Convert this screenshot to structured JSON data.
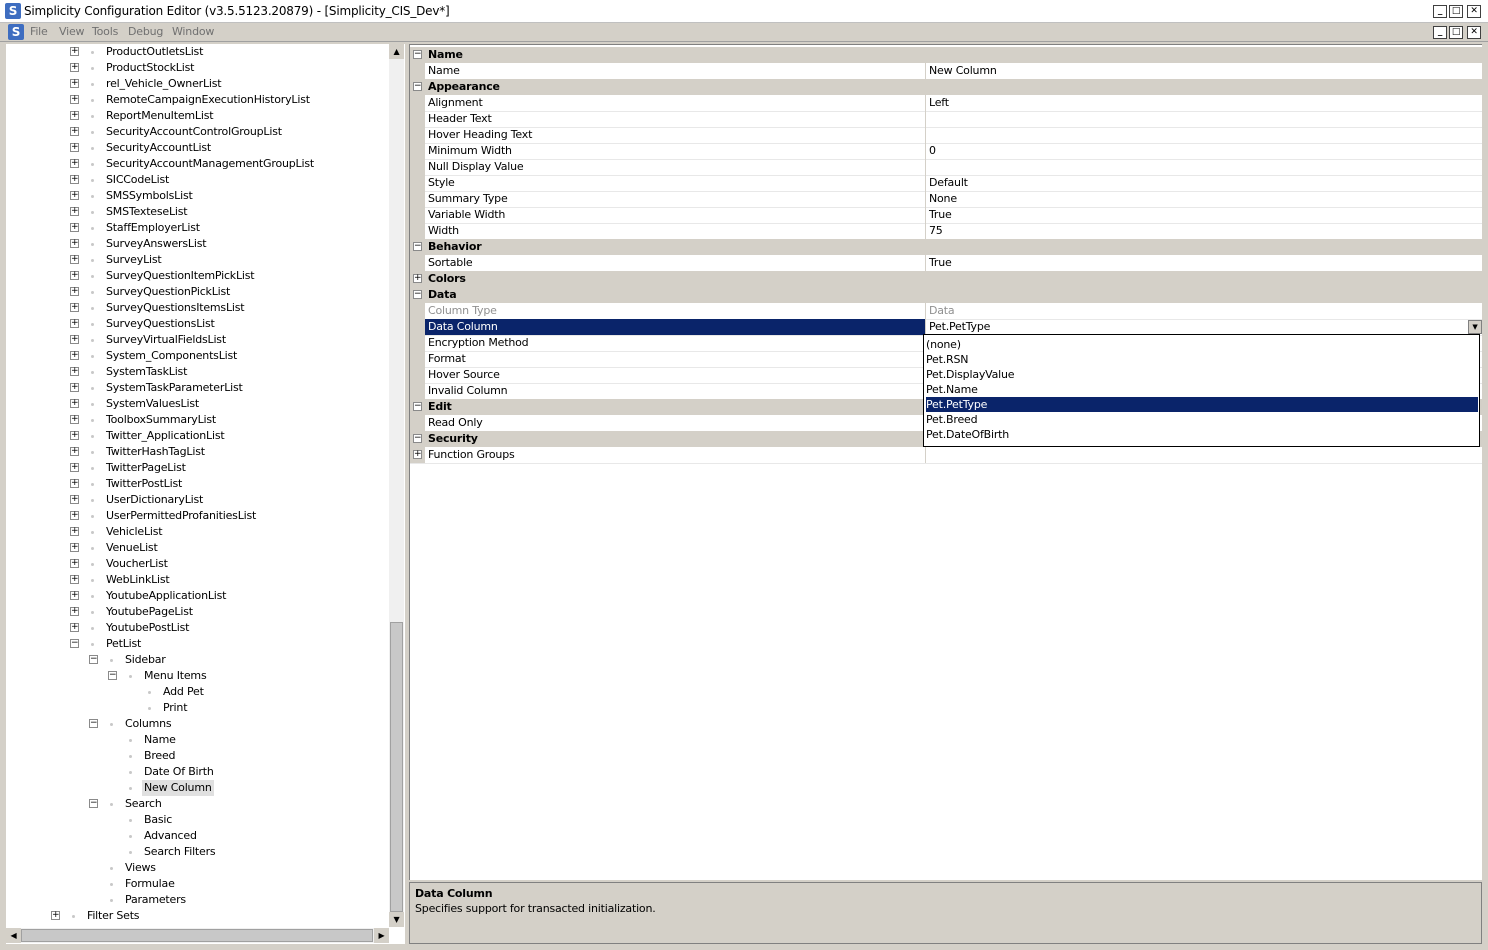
{
  "window": {
    "title": "Simplicity Configuration Editor (v3.5.5123.20879) - [Simplicity_CIS_Dev*]",
    "app_icon": "S",
    "minimize": "_",
    "maximize": "□",
    "close": "✕"
  },
  "menu": {
    "items": [
      "File",
      "View",
      "Tools",
      "Debug",
      "Window"
    ]
  },
  "tree": {
    "items": [
      {
        "label": "ProductOutletsList",
        "depth": 0,
        "expander": "+"
      },
      {
        "label": "ProductStockList",
        "depth": 0,
        "expander": "+"
      },
      {
        "label": "rel_Vehicle_OwnerList",
        "depth": 0,
        "expander": "+"
      },
      {
        "label": "RemoteCampaignExecutionHistoryList",
        "depth": 0,
        "expander": "+"
      },
      {
        "label": "ReportMenuItemList",
        "depth": 0,
        "expander": "+"
      },
      {
        "label": "SecurityAccountControlGroupList",
        "depth": 0,
        "expander": "+"
      },
      {
        "label": "SecurityAccountList",
        "depth": 0,
        "expander": "+"
      },
      {
        "label": "SecurityAccountManagementGroupList",
        "depth": 0,
        "expander": "+"
      },
      {
        "label": "SICCodeList",
        "depth": 0,
        "expander": "+"
      },
      {
        "label": "SMSSymbolsList",
        "depth": 0,
        "expander": "+"
      },
      {
        "label": "SMSTexteseList",
        "depth": 0,
        "expander": "+"
      },
      {
        "label": "StaffEmployerList",
        "depth": 0,
        "expander": "+"
      },
      {
        "label": "SurveyAnswersList",
        "depth": 0,
        "expander": "+"
      },
      {
        "label": "SurveyList",
        "depth": 0,
        "expander": "+"
      },
      {
        "label": "SurveyQuestionItemPickList",
        "depth": 0,
        "expander": "+"
      },
      {
        "label": "SurveyQuestionPickList",
        "depth": 0,
        "expander": "+"
      },
      {
        "label": "SurveyQuestionsItemsList",
        "depth": 0,
        "expander": "+"
      },
      {
        "label": "SurveyQuestionsList",
        "depth": 0,
        "expander": "+"
      },
      {
        "label": "SurveyVirtualFieldsList",
        "depth": 0,
        "expander": "+"
      },
      {
        "label": "System_ComponentsList",
        "depth": 0,
        "expander": "+"
      },
      {
        "label": "SystemTaskList",
        "depth": 0,
        "expander": "+"
      },
      {
        "label": "SystemTaskParameterList",
        "depth": 0,
        "expander": "+"
      },
      {
        "label": "SystemValuesList",
        "depth": 0,
        "expander": "+"
      },
      {
        "label": "ToolboxSummaryList",
        "depth": 0,
        "expander": "+"
      },
      {
        "label": "Twitter_ApplicationList",
        "depth": 0,
        "expander": "+"
      },
      {
        "label": "TwitterHashTagList",
        "depth": 0,
        "expander": "+"
      },
      {
        "label": "TwitterPageList",
        "depth": 0,
        "expander": "+"
      },
      {
        "label": "TwitterPostList",
        "depth": 0,
        "expander": "+"
      },
      {
        "label": "UserDictionaryList",
        "depth": 0,
        "expander": "+"
      },
      {
        "label": "UserPermittedProfanitiesList",
        "depth": 0,
        "expander": "+"
      },
      {
        "label": "VehicleList",
        "depth": 0,
        "expander": "+"
      },
      {
        "label": "VenueList",
        "depth": 0,
        "expander": "+"
      },
      {
        "label": "VoucherList",
        "depth": 0,
        "expander": "+"
      },
      {
        "label": "WebLinkList",
        "depth": 0,
        "expander": "+"
      },
      {
        "label": "YoutubeApplicationList",
        "depth": 0,
        "expander": "+"
      },
      {
        "label": "YoutubePageList",
        "depth": 0,
        "expander": "+"
      },
      {
        "label": "YoutubePostList",
        "depth": 0,
        "expander": "+"
      },
      {
        "label": "PetList",
        "depth": 0,
        "expander": "-"
      },
      {
        "label": "Sidebar",
        "depth": 1,
        "expander": "-"
      },
      {
        "label": "Menu Items",
        "depth": 2,
        "expander": "-"
      },
      {
        "label": "Add Pet",
        "depth": 3,
        "expander": ""
      },
      {
        "label": "Print",
        "depth": 3,
        "expander": ""
      },
      {
        "label": "Columns",
        "depth": 1,
        "expander": "-"
      },
      {
        "label": "Name",
        "depth": 2,
        "expander": ""
      },
      {
        "label": "Breed",
        "depth": 2,
        "expander": ""
      },
      {
        "label": "Date Of Birth",
        "depth": 2,
        "expander": ""
      },
      {
        "label": "New Column",
        "depth": 2,
        "expander": "",
        "selected": true
      },
      {
        "label": "Search",
        "depth": 1,
        "expander": "-"
      },
      {
        "label": "Basic",
        "depth": 2,
        "expander": ""
      },
      {
        "label": "Advanced",
        "depth": 2,
        "expander": ""
      },
      {
        "label": "Search Filters",
        "depth": 2,
        "expander": ""
      },
      {
        "label": "Views",
        "depth": 1,
        "expander": ""
      },
      {
        "label": "Formulae",
        "depth": 1,
        "expander": ""
      },
      {
        "label": "Parameters",
        "depth": 1,
        "expander": ""
      },
      {
        "label": "Filter Sets",
        "depth": -1,
        "expander": "+"
      }
    ]
  },
  "properties": {
    "rows": [
      {
        "type": "category",
        "label": "Name",
        "expander": "-"
      },
      {
        "type": "prop",
        "name": "Name",
        "value": "New Column"
      },
      {
        "type": "category",
        "label": "Appearance",
        "expander": "-"
      },
      {
        "type": "prop",
        "name": "Alignment",
        "value": "Left"
      },
      {
        "type": "prop",
        "name": "Header Text",
        "value": ""
      },
      {
        "type": "prop",
        "name": "Hover Heading Text",
        "value": ""
      },
      {
        "type": "prop",
        "name": "Minimum Width",
        "value": "0"
      },
      {
        "type": "prop",
        "name": "Null Display Value",
        "value": ""
      },
      {
        "type": "prop",
        "name": "Style",
        "value": "Default"
      },
      {
        "type": "prop",
        "name": "Summary Type",
        "value": "None"
      },
      {
        "type": "prop",
        "name": "Variable Width",
        "value": "True"
      },
      {
        "type": "prop",
        "name": "Width",
        "value": "75"
      },
      {
        "type": "category",
        "label": "Behavior",
        "expander": "-"
      },
      {
        "type": "prop",
        "name": "Sortable",
        "value": "True"
      },
      {
        "type": "category",
        "label": "Colors",
        "expander": "+"
      },
      {
        "type": "category",
        "label": "Data",
        "expander": "-"
      },
      {
        "type": "prop",
        "name": "Column Type",
        "value": "Data",
        "disabled": true
      },
      {
        "type": "prop",
        "name": "Data Column",
        "value": "Pet.PetType",
        "selected": true
      },
      {
        "type": "prop",
        "name": "Encryption Method",
        "value": ""
      },
      {
        "type": "prop",
        "name": "Format",
        "value": ""
      },
      {
        "type": "prop",
        "name": "Hover Source",
        "value": ""
      },
      {
        "type": "prop",
        "name": "Invalid Column",
        "value": ""
      },
      {
        "type": "category",
        "label": "Edit",
        "expander": "-"
      },
      {
        "type": "prop",
        "name": "Read Only",
        "value": ""
      },
      {
        "type": "category",
        "label": "Security",
        "expander": "-"
      },
      {
        "type": "prop",
        "name": "Function Groups",
        "value": "",
        "expander": "+"
      }
    ]
  },
  "dropdown": {
    "options": [
      "(none)",
      "Pet.RSN",
      "Pet.DisplayValue",
      "Pet.Name",
      "Pet.PetType",
      "Pet.Breed",
      "Pet.DateOfBirth"
    ],
    "selected_index": 4
  },
  "description": {
    "title": "Data Column",
    "text": "Specifies support for transacted initialization."
  },
  "colors": {
    "selection": "#0a246a",
    "panel": "#d4d0c8"
  }
}
